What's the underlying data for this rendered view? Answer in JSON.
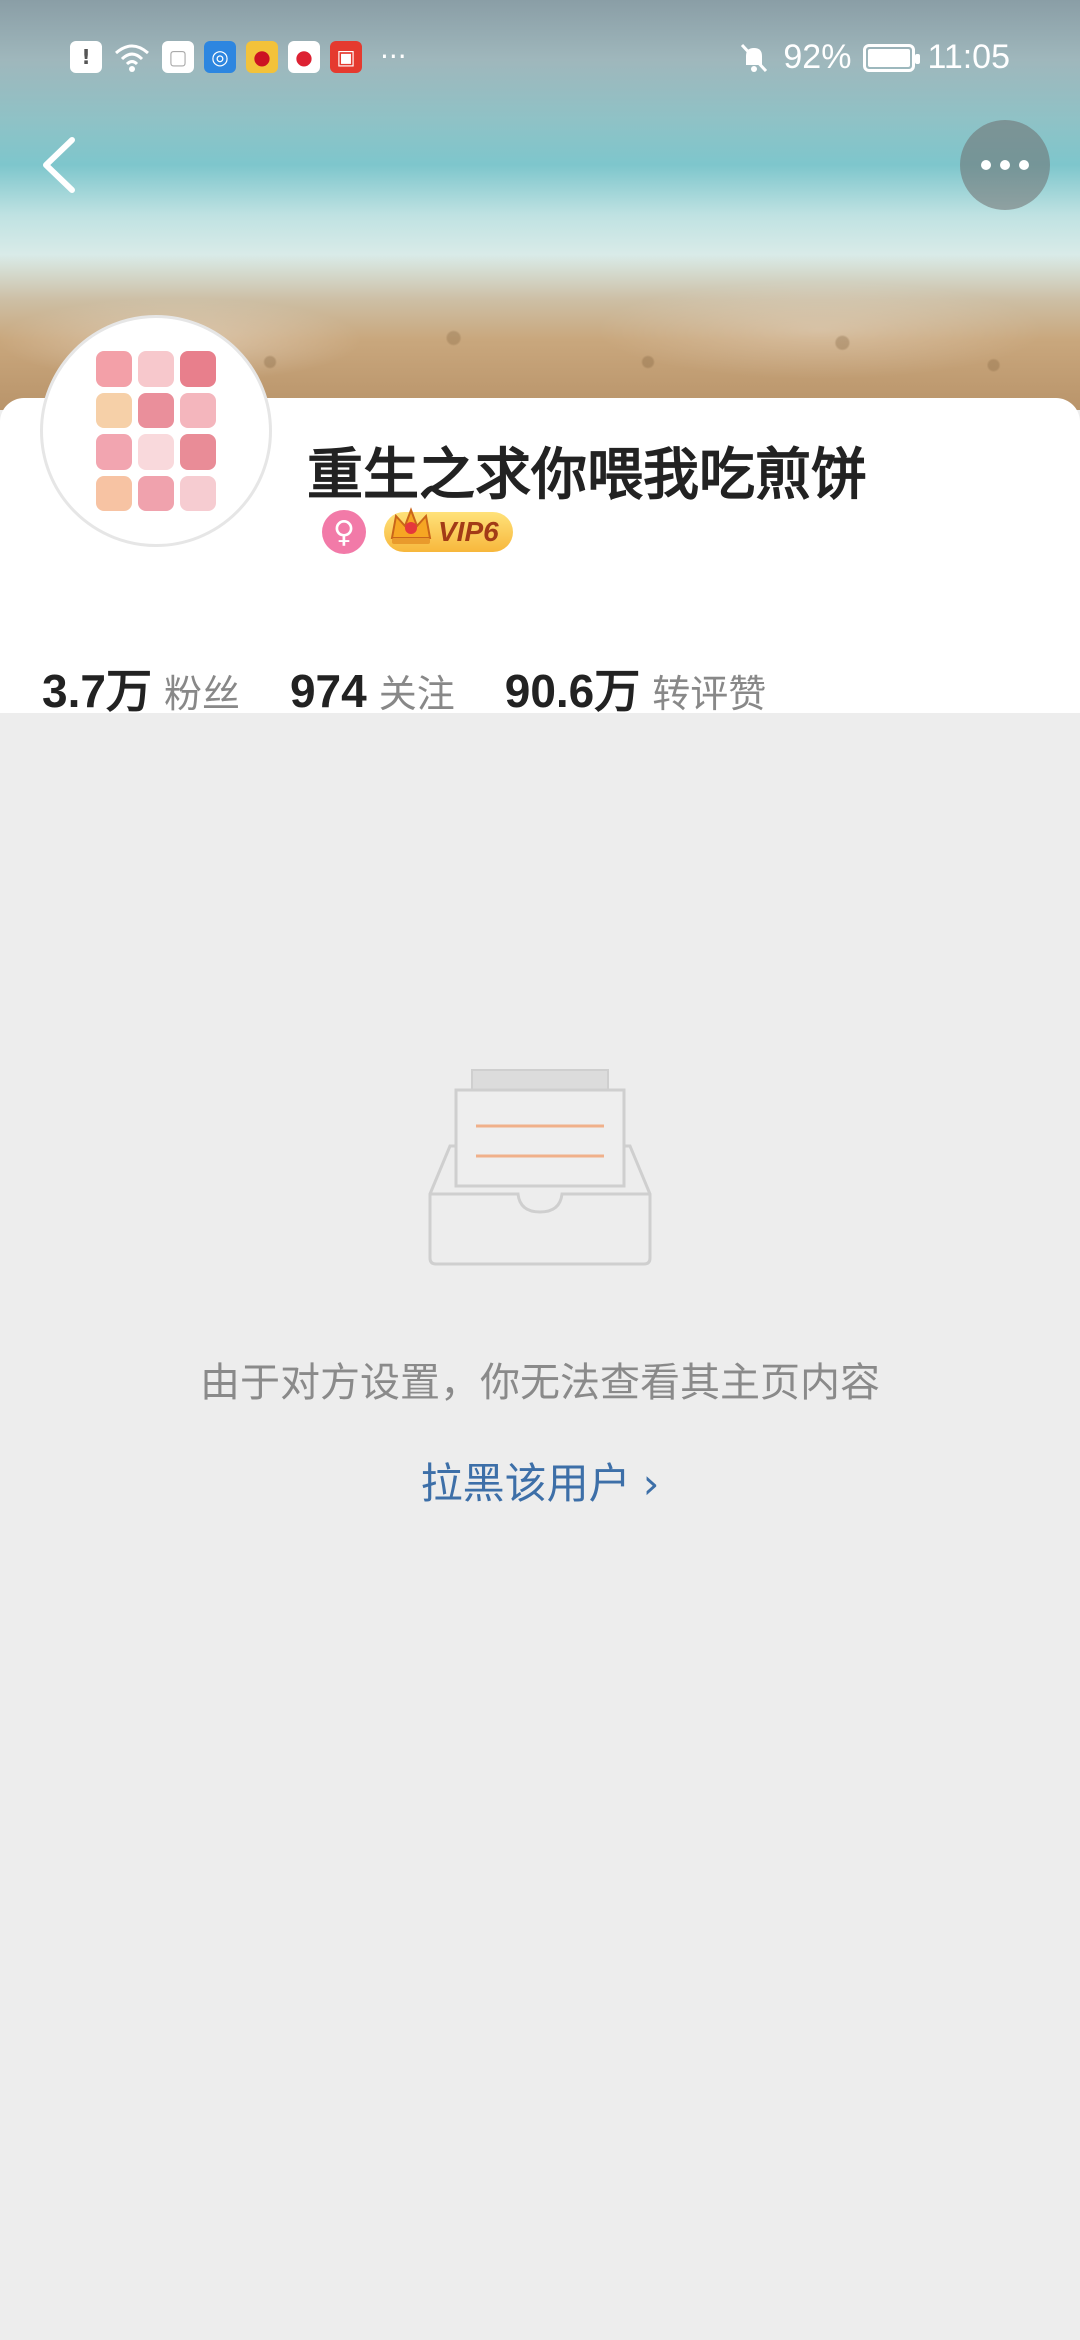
{
  "status_bar": {
    "battery_percent": "92%",
    "time": "11:05",
    "more": "···",
    "icons": [
      "alert-icon",
      "wifi-icon",
      "notification-app-icon",
      "browser-app-icon",
      "weibo-icon",
      "weibo-icon",
      "video-app-icon"
    ]
  },
  "profile": {
    "username": "重生之求你喂我吃煎饼",
    "vip_label": "VIP6",
    "gender": "female",
    "stats": [
      {
        "value": "3.7万",
        "label": "粉丝"
      },
      {
        "value": "974",
        "label": "关注"
      },
      {
        "value": "90.6万",
        "label": "转评赞"
      }
    ]
  },
  "empty_state": {
    "message": "由于对方设置，你无法查看其主页内容",
    "action_label": "拉黑该用户",
    "action_chevron": "›"
  },
  "colors": {
    "accent_link": "#3d6fa8",
    "background": "#ededed",
    "vip_gold": "#f7b73c",
    "gender_pink": "#f27aa8"
  }
}
